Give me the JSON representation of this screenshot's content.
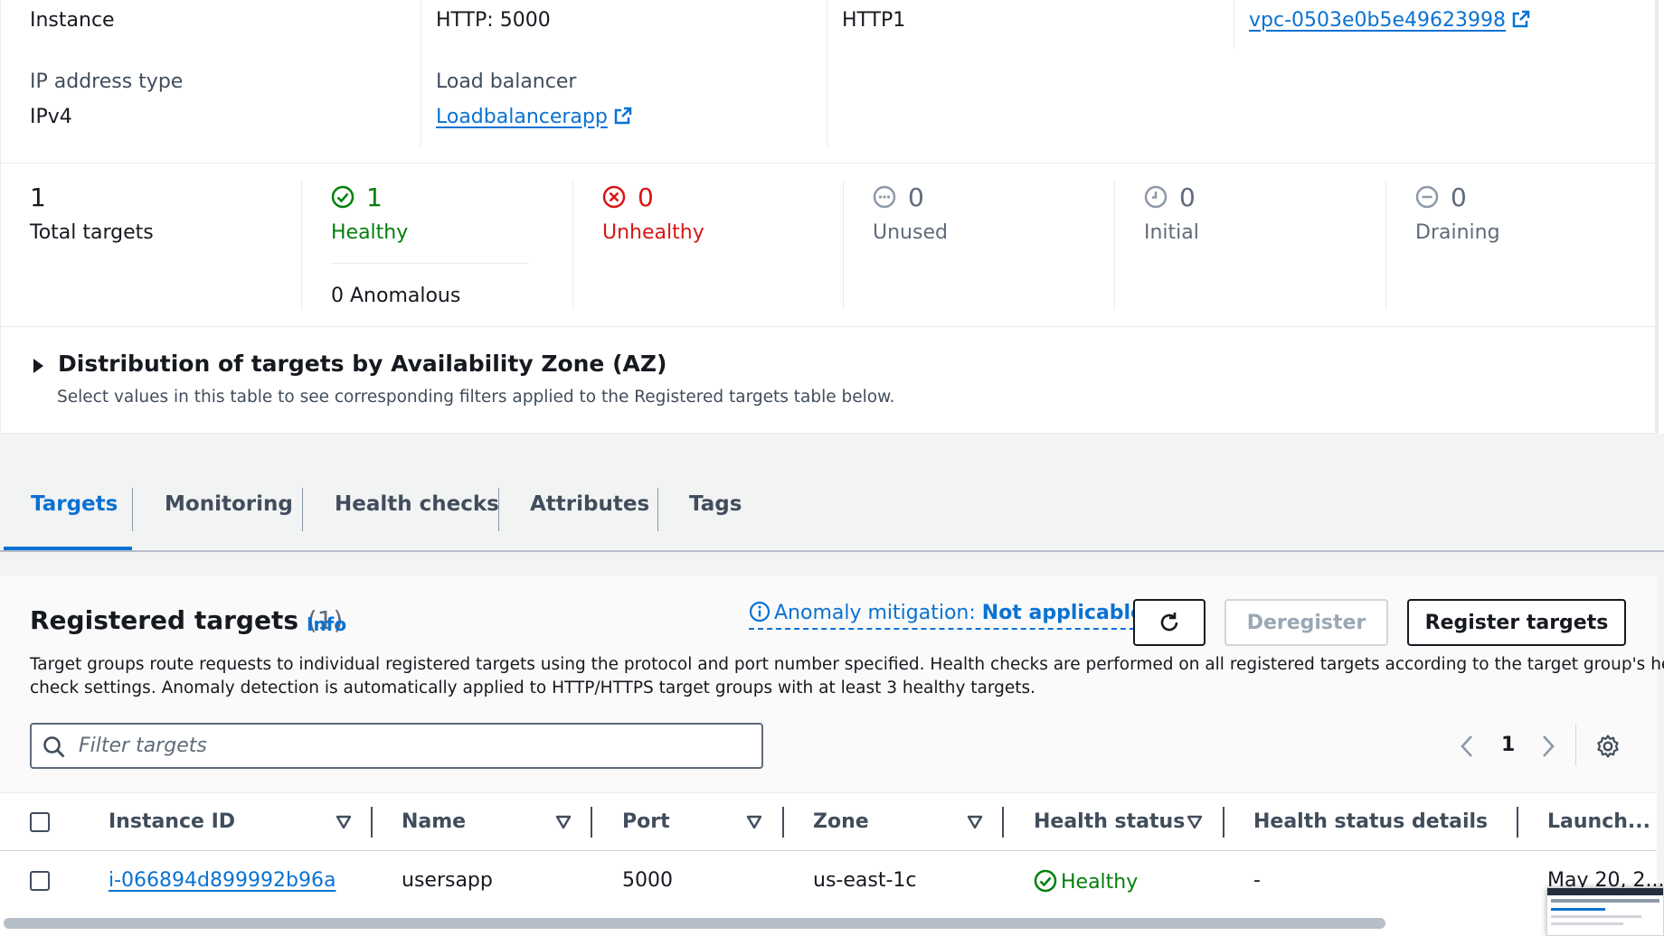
{
  "details": {
    "target_type_label": "Instance",
    "protocol_port": "HTTP: 5000",
    "protocol_version": "HTTP1",
    "vpc_link": "vpc-0503e0b5e49623998",
    "ip_type_label": "IP address type",
    "ip_type_value": "IPv4",
    "lb_label": "Load balancer",
    "lb_link": "Loadbalancerapp"
  },
  "stats": {
    "total": {
      "count": "1",
      "label": "Total targets"
    },
    "healthy": {
      "count": "1",
      "label": "Healthy",
      "anomalous": "0 Anomalous"
    },
    "unhealthy": {
      "count": "0",
      "label": "Unhealthy"
    },
    "unused": {
      "count": "0",
      "label": "Unused"
    },
    "initial": {
      "count": "0",
      "label": "Initial"
    },
    "draining": {
      "count": "0",
      "label": "Draining"
    }
  },
  "az": {
    "title": "Distribution of targets by Availability Zone (AZ)",
    "subtitle": "Select values in this table to see corresponding filters applied to the Registered targets table below."
  },
  "tabs": [
    "Targets",
    "Monitoring",
    "Health checks",
    "Attributes",
    "Tags"
  ],
  "registered": {
    "title": "Registered targets",
    "count": "(1)",
    "info": "Info",
    "anomaly_label": "Anomaly mitigation:",
    "anomaly_value": "Not applicable",
    "deregister": "Deregister",
    "register": "Register targets",
    "description_line1": "Target groups route requests to individual registered targets using the protocol and port number specified. Health checks are performed on all registered targets according to the target group's health",
    "description_line2": "check settings. Anomaly detection is automatically applied to HTTP/HTTPS target groups with at least 3 healthy targets.",
    "filter_placeholder": "Filter targets",
    "page": "1"
  },
  "table": {
    "headers": [
      "Instance ID",
      "Name",
      "Port",
      "Zone",
      "Health status",
      "Health status details",
      "Launch..."
    ],
    "rows": [
      {
        "instance_id": "i-066894d899992b96a",
        "name": "usersapp",
        "port": "5000",
        "zone": "us-east-1c",
        "health": "Healthy",
        "details": "-",
        "launch": "May 20, 2..."
      }
    ]
  },
  "colors": {
    "link": "#0972d3",
    "healthy": "#037f0c",
    "unhealthy": "#d91515",
    "muted": "#8d99a8"
  }
}
